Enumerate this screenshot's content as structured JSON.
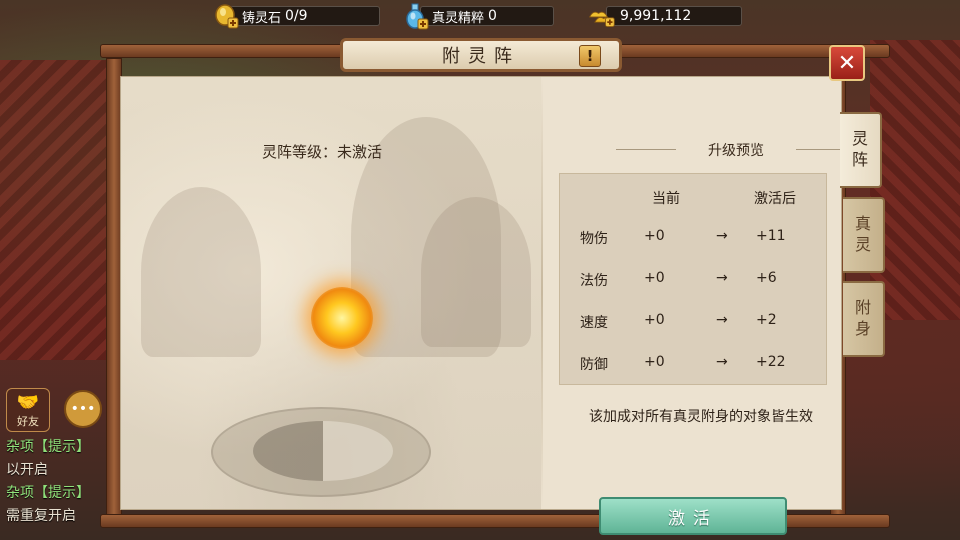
{
  "resources": {
    "casting_stone": {
      "label": "铸灵石",
      "value": "0/9",
      "icon": "gold-ingot-plus-icon"
    },
    "spirit_essence": {
      "label": "真灵精粹",
      "value": "0",
      "icon": "blue-flask-plus-icon"
    },
    "gold": {
      "value": "9,991,112",
      "icon": "gold-ingots-plus-icon"
    }
  },
  "panel": {
    "title": "附灵阵",
    "help_label": "!",
    "close_label": "✕"
  },
  "left": {
    "level_text": "灵阵等级：未激活"
  },
  "preview": {
    "title": "升级预览",
    "headers": {
      "current": "当前",
      "after": "激活后"
    },
    "rows": [
      {
        "stat": "物伤",
        "current": "+0",
        "arrow": "→",
        "after": "+11"
      },
      {
        "stat": "法伤",
        "current": "+0",
        "arrow": "→",
        "after": "+6"
      },
      {
        "stat": "速度",
        "current": "+0",
        "arrow": "→",
        "after": "+2"
      },
      {
        "stat": "防御",
        "current": "+0",
        "arrow": "→",
        "after": "+22"
      }
    ],
    "note": "该加成对所有真灵附身的对象皆生效",
    "activate_label": "激活"
  },
  "tabs": [
    {
      "line1": "灵",
      "line2": "阵"
    },
    {
      "line1": "真",
      "line2": "灵"
    },
    {
      "line1": "附",
      "line2": "身"
    }
  ],
  "chat": {
    "friend_label": "好友",
    "lines": [
      {
        "tag": "杂项",
        "suffix": "【提示】"
      },
      {
        "text": "以开启"
      },
      {
        "tag": "杂项",
        "suffix": "【提示】"
      },
      {
        "text": "需重复开启"
      }
    ]
  },
  "colors": {
    "accent_green": "#5fb496",
    "close_red": "#c8382a",
    "frame_brown": "#8a5a32"
  }
}
